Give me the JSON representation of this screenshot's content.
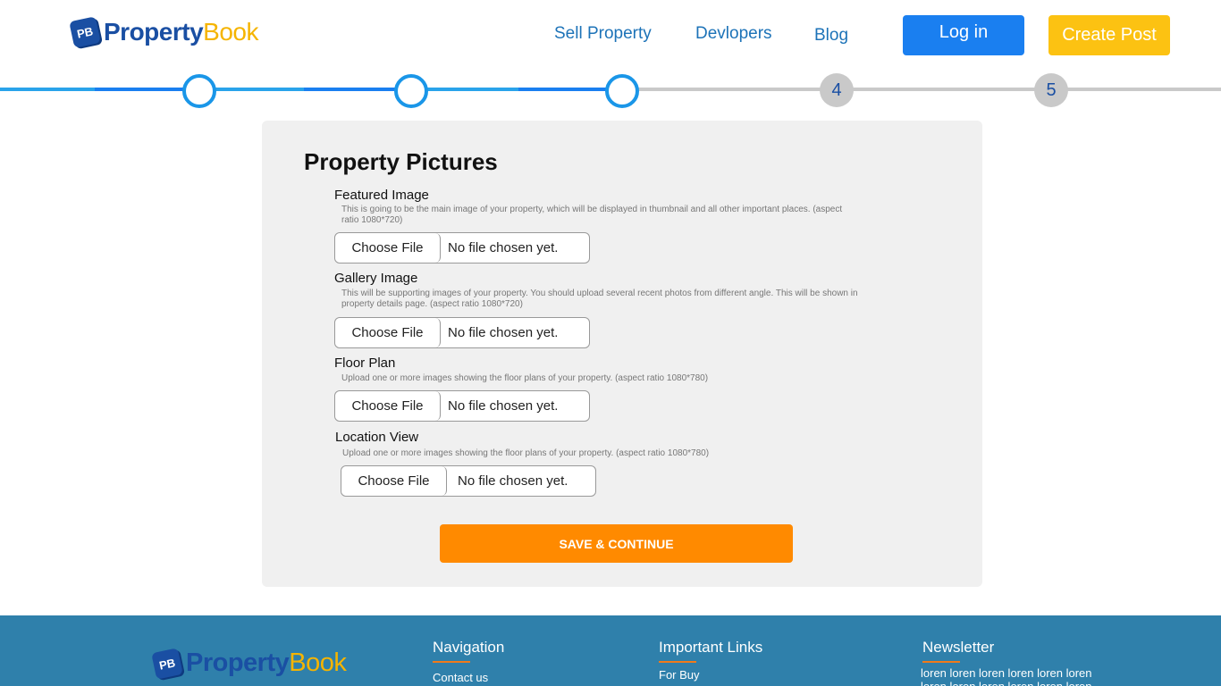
{
  "brand": {
    "name_part1": "Property",
    "name_part2": "Book",
    "mark": "PB"
  },
  "nav": {
    "sell": "Sell Property",
    "developers": "Devlopers",
    "blog": "Blog"
  },
  "header": {
    "login": "Log in",
    "create_post": "Create Post"
  },
  "stepper": {
    "current_step": 3,
    "total_steps": 5,
    "steps": [
      {
        "label": "",
        "state": "done"
      },
      {
        "label": "",
        "state": "done"
      },
      {
        "label": "",
        "state": "done"
      },
      {
        "label": "4",
        "state": "todo"
      },
      {
        "label": "5",
        "state": "todo"
      }
    ]
  },
  "form": {
    "title": "Property Pictures",
    "fields": [
      {
        "label": "Featured Image",
        "hint": "This is going to be the main image of your property, which will be displayed in thumbnail and all other important places. (aspect ratio 1080*720)",
        "button": "Choose File",
        "status": "No file chosen yet."
      },
      {
        "label": "Gallery Image",
        "hint": "This will be supporting images of your property. You should upload several recent photos from different angle. This will be shown in property details page. (aspect ratio 1080*720)",
        "button": "Choose File",
        "status": "No file chosen yet."
      },
      {
        "label": "Floor Plan",
        "hint": "Upload one or more images showing the floor plans of your property. (aspect ratio 1080*780)",
        "button": "Choose File",
        "status": "No file chosen yet."
      },
      {
        "label": "Location View",
        "hint": "Upload one or more images showing the floor plans of your property. (aspect ratio 1080*780)",
        "button": "Choose File",
        "status": "No file chosen yet."
      }
    ],
    "submit": "SAVE & CONTINUE"
  },
  "footer": {
    "navigation": {
      "heading": "Navigation",
      "links": [
        "Contact us"
      ]
    },
    "important": {
      "heading": "Important Links",
      "links": [
        "For Buy"
      ]
    },
    "newsletter": {
      "heading": "Newsletter",
      "text": "loren loren loren loren loren loren loren loren loren loren loren loren"
    }
  },
  "colors": {
    "primary_blue": "#1a7ff0",
    "brand_blue": "#1a4fa3",
    "accent_yellow": "#fcc212",
    "cta_orange": "#ff8a00",
    "footer_bg": "#2f80ab"
  }
}
